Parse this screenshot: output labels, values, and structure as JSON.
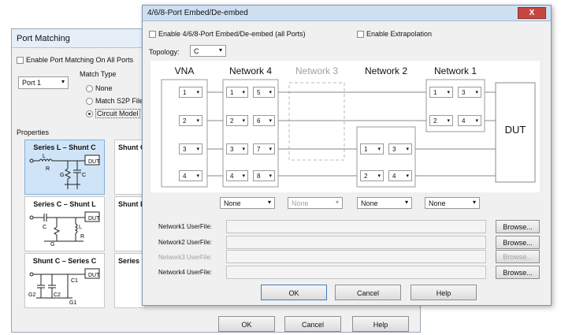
{
  "port_matching": {
    "title": "Port Matching",
    "enable_label": "Enable Port Matching On All Ports",
    "port_select": "Port 1",
    "match_type_label": "Match Type",
    "match_options": [
      {
        "label": "None",
        "selected": false
      },
      {
        "label": "Match S2P File",
        "selected": false
      },
      {
        "label": "Circuit Model",
        "selected": true
      }
    ],
    "properties_label": "Properties",
    "circuits": [
      {
        "label": "Series L – Shunt C",
        "selected": true
      },
      {
        "label": "Shunt C",
        "selected": false
      },
      {
        "label": "Series C – Shunt L",
        "selected": false
      },
      {
        "label": "Shunt L",
        "selected": false
      },
      {
        "label": "Shunt C – Series C",
        "selected": false
      },
      {
        "label": "Series",
        "selected": false
      }
    ],
    "ok_label": "OK",
    "cancel_label": "Cancel",
    "help_label": "Help"
  },
  "embed": {
    "title": "4/6/8-Port Embed/De-embed",
    "close_glyph": "X",
    "enable_label": "Enable 4/6/8-Port Embed/De-embed (all Ports)",
    "extrapolation_label": "Enable Extrapolation",
    "topology_label": "Topology:",
    "topology_value": "C",
    "headers": [
      "VNA",
      "Network 4",
      "Network 3",
      "Network 2",
      "Network 1"
    ],
    "dut_label": "DUT",
    "vna_ports": [
      "1",
      "2",
      "3",
      "4"
    ],
    "net4_left": [
      "1",
      "2",
      "3",
      "4"
    ],
    "net4_right": [
      "5",
      "6",
      "7",
      "8"
    ],
    "net2_left": [
      "1",
      "2"
    ],
    "net2_right": [
      "3",
      "4"
    ],
    "net1_left": [
      "1",
      "2"
    ],
    "net1_right": [
      "3",
      "4"
    ],
    "net_selects": [
      "None",
      "None",
      "None",
      "None"
    ],
    "userfiles": [
      {
        "label": "Network1 UserFile:",
        "browse": "Browse...",
        "enabled": true
      },
      {
        "label": "Network2 UserFile:",
        "browse": "Browse...",
        "enabled": true
      },
      {
        "label": "Network3 UserFile:",
        "browse": "Browse...",
        "enabled": false
      },
      {
        "label": "Network4 UserFile:",
        "browse": "Browse...",
        "enabled": true
      }
    ],
    "ok_label": "OK",
    "cancel_label": "Cancel",
    "help_label": "Help"
  }
}
